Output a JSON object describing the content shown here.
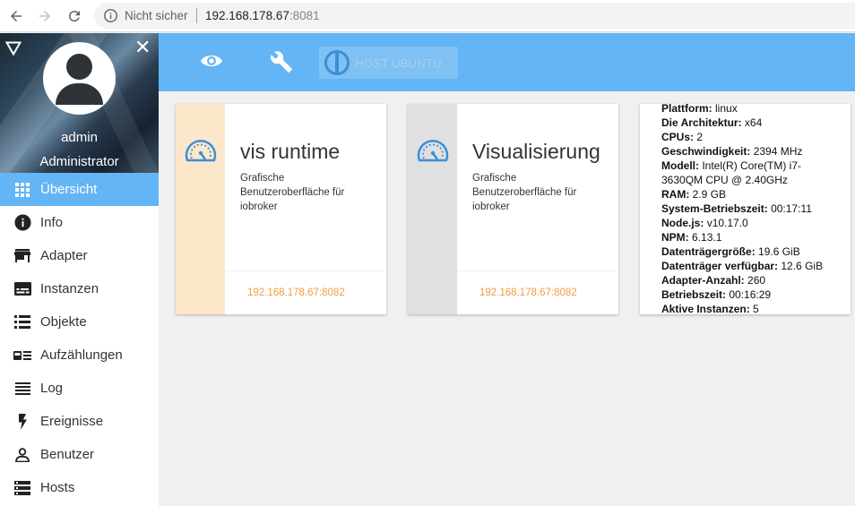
{
  "browser": {
    "security_label": "Nicht sicher",
    "url_host": "192.168.178.67",
    "url_port": ":8081"
  },
  "sidebar": {
    "user_name": "admin",
    "user_role": "Administrator",
    "items": [
      {
        "label": "Übersicht",
        "icon": "grid-icon",
        "active": true
      },
      {
        "label": "Info",
        "icon": "info-icon"
      },
      {
        "label": "Adapter",
        "icon": "store-icon"
      },
      {
        "label": "Instanzen",
        "icon": "subtitles-icon"
      },
      {
        "label": "Objekte",
        "icon": "list-icon"
      },
      {
        "label": "Aufzählungen",
        "icon": "featured-list-icon"
      },
      {
        "label": "Log",
        "icon": "lines-icon"
      },
      {
        "label": "Ereignisse",
        "icon": "flash-icon"
      },
      {
        "label": "Benutzer",
        "icon": "person-icon"
      },
      {
        "label": "Hosts",
        "icon": "storage-icon"
      }
    ]
  },
  "toolbar": {
    "host_label": "HOST UBUNTU"
  },
  "cards": [
    {
      "title": "vis runtime",
      "description": "Grafische Benutzeroberfläche für iobroker",
      "link": "192.168.178.67:8082",
      "strip_color": "#fde7cb"
    },
    {
      "title": "Visualisierung",
      "description": "Grafische Benutzeroberfläche für iobroker",
      "link": "192.168.178.67:8082",
      "strip_color": "#e0e0e0"
    }
  ],
  "system_info": [
    {
      "key": "Plattform:",
      "value": "linux"
    },
    {
      "key": "Die Architektur:",
      "value": "x64"
    },
    {
      "key": "CPUs:",
      "value": "2"
    },
    {
      "key": "Geschwindigkeit:",
      "value": "2394 MHz"
    },
    {
      "key": "Modell:",
      "value": "Intel(R) Core(TM) i7-3630QM CPU @ 2.40GHz"
    },
    {
      "key": "RAM:",
      "value": "2.9 GB"
    },
    {
      "key": "System-Betriebszeit:",
      "value": "00:17:11"
    },
    {
      "key": "Node.js:",
      "value": "v10.17.0"
    },
    {
      "key": "NPM:",
      "value": "6.13.1"
    },
    {
      "key": "Datenträgergröße:",
      "value": "19.6 GiB"
    },
    {
      "key": "Datenträger verfügbar:",
      "value": "12.6 GiB"
    },
    {
      "key": "Adapter-Anzahl:",
      "value": "260"
    },
    {
      "key": "Betriebszeit:",
      "value": "00:16:29"
    },
    {
      "key": "Aktive Instanzen:",
      "value": "5"
    }
  ],
  "colors": {
    "accent": "#64b5f6",
    "link": "#ef9d40"
  }
}
